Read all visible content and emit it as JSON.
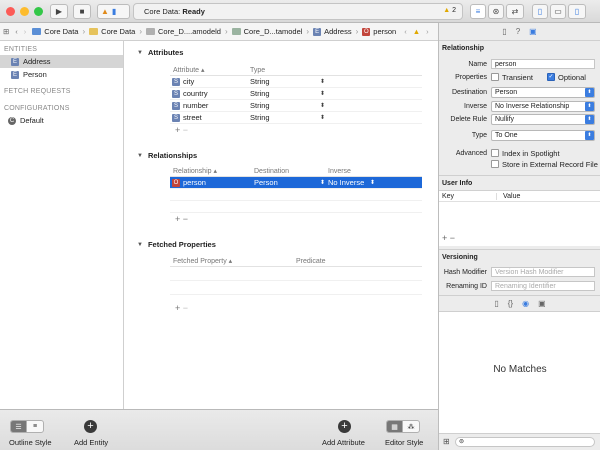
{
  "toolbar": {
    "status_prefix": "Core Data:",
    "status_value": "Ready",
    "warning_count": "2"
  },
  "jumpbar": {
    "items": [
      "Core Data",
      "Core Data",
      "Core_D....amodeld",
      "Core_D...tamodel",
      "Address",
      "person"
    ]
  },
  "sidebar": {
    "entities_header": "ENTITIES",
    "entities": [
      "Address",
      "Person"
    ],
    "fetch_requests_header": "FETCH REQUESTS",
    "configurations_header": "CONFIGURATIONS",
    "configurations": [
      "Default"
    ]
  },
  "attributes": {
    "title": "Attributes",
    "col_attribute": "Attribute",
    "col_type": "Type",
    "rows": [
      {
        "name": "city",
        "type": "String"
      },
      {
        "name": "country",
        "type": "String"
      },
      {
        "name": "number",
        "type": "String"
      },
      {
        "name": "street",
        "type": "String"
      }
    ]
  },
  "relationships": {
    "title": "Relationships",
    "col_relationship": "Relationship",
    "col_destination": "Destination",
    "col_inverse": "Inverse",
    "rows": [
      {
        "name": "person",
        "destination": "Person",
        "inverse": "No Inverse"
      }
    ]
  },
  "fetched_properties": {
    "title": "Fetched Properties",
    "col_fetched_property": "Fetched Property",
    "col_predicate": "Predicate"
  },
  "bottom": {
    "outline_style": "Outline Style",
    "add_entity": "Add Entity",
    "add_attribute": "Add Attribute",
    "editor_style": "Editor Style"
  },
  "inspector": {
    "relationship_title": "Relationship",
    "name_label": "Name",
    "name_value": "person",
    "properties_label": "Properties",
    "transient_label": "Transient",
    "optional_label": "Optional",
    "destination_label": "Destination",
    "destination_value": "Person",
    "inverse_label": "Inverse",
    "inverse_value": "No Inverse Relationship",
    "delete_rule_label": "Delete Rule",
    "delete_rule_value": "Nullify",
    "type_label": "Type",
    "type_value": "To One",
    "advanced_label": "Advanced",
    "index_spotlight_label": "Index in Spotlight",
    "external_record_label": "Store in External Record File",
    "user_info_title": "User Info",
    "key_col": "Key",
    "value_col": "Value",
    "versioning_title": "Versioning",
    "hash_modifier_label": "Hash Modifier",
    "hash_modifier_placeholder": "Version Hash Modifier",
    "renaming_id_label": "Renaming ID",
    "renaming_id_placeholder": "Renaming Identifier",
    "no_matches": "No Matches"
  },
  "colors": {
    "selection_blue": "#1d68d8",
    "accent_blue": "#3b7de0"
  }
}
